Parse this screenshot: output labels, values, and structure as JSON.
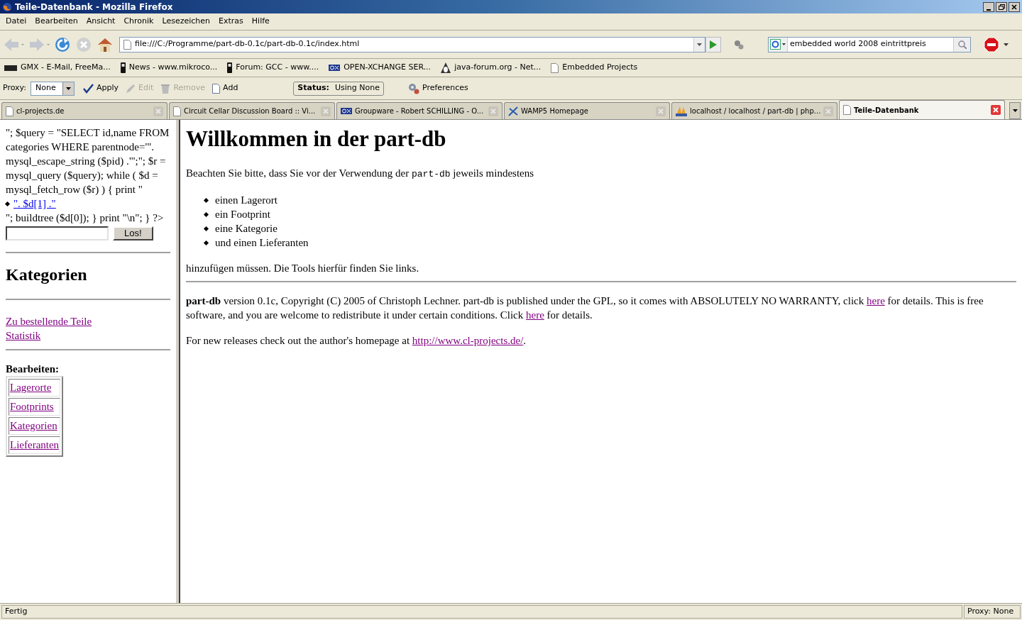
{
  "window": {
    "title": "Teile-Datenbank - Mozilla Firefox"
  },
  "menu": [
    "Datei",
    "Bearbeiten",
    "Ansicht",
    "Chronik",
    "Lesezeichen",
    "Extras",
    "Hilfe"
  ],
  "navigation": {
    "url": "file:///C:/Programme/part-db-0.1c/part-db-0.1c/index.html",
    "search": "embedded world 2008 eintrittpreis"
  },
  "bookmarks": [
    {
      "label": "GMX - E-Mail, FreeMa...",
      "kind": "gmx"
    },
    {
      "label": "News - www.mikroco...",
      "kind": "phone"
    },
    {
      "label": "Forum: GCC - www....",
      "kind": "phone"
    },
    {
      "label": "OPEN-XCHANGE SER...",
      "kind": "ox"
    },
    {
      "label": "java-forum.org - Net...",
      "kind": "java"
    },
    {
      "label": "Embedded Projects",
      "kind": "page"
    }
  ],
  "proxy_toolbar": {
    "label": "Proxy:",
    "value": "None",
    "buttons": [
      {
        "label": "Apply",
        "kind": "apply",
        "disabled": false
      },
      {
        "label": "Edit",
        "kind": "edit",
        "disabled": true
      },
      {
        "label": "Remove",
        "kind": "remove",
        "disabled": true
      },
      {
        "label": "Add",
        "kind": "add",
        "disabled": false
      }
    ],
    "status_label": "Status:",
    "status_value": "Using None",
    "preferences": "Preferences"
  },
  "tabs": [
    {
      "label": "cl-projects.de",
      "kind": "page",
      "selected": false
    },
    {
      "label": "Circuit Cellar Discussion Board :: Vi...",
      "kind": "page",
      "selected": false
    },
    {
      "label": "Groupware - Robert SCHILLING - O...",
      "kind": "ox",
      "selected": false
    },
    {
      "label": "WAMP5 Homepage",
      "kind": "wamp",
      "selected": false
    },
    {
      "label": "localhost / localhost / part-db | php...",
      "kind": "pma",
      "selected": false
    },
    {
      "label": "Teile-Datenbank",
      "kind": "page",
      "selected": true
    }
  ],
  "sidebar": {
    "code_text": "\"; $query = \"SELECT id,name FROM categories WHERE parentnode='\". mysql_escape_string ($pid) .\"';\"; $r = mysql_query ($query); while ( $d = mysql_fetch_row ($r) ) { print \"",
    "bullet_link": "\". $d[1] .\"",
    "after_text": "\"; buildtree ($d[0]); } print \"\\n\"; } ?>",
    "search_button": "Los!",
    "heading": "Kategorien",
    "links": [
      "Zu bestellende Teile",
      "Statistik"
    ],
    "edit_heading": "Bearbeiten:",
    "edit_links": [
      "Lagerorte",
      "Footprints",
      "Kategorien",
      "Lieferanten"
    ]
  },
  "main": {
    "heading": "Willkommen in der part-db",
    "intro_before": "Beachten Sie bitte, dass Sie vor der Verwendung der",
    "intro_code": "part-db",
    "intro_after": "jeweils mindestens",
    "list": [
      "einen Lagerort",
      "ein Footprint",
      "eine Kategorie",
      "und einen Lieferanten"
    ],
    "outro": "hinzufügen müssen. Die Tools hierfür finden Sie links.",
    "license": [
      {
        "kind": "text",
        "text": "**part-db** version 0.1c, Copyright (C) 2005 of Christoph Lechner. part-db is published under the GPL, so it comes with ABSOLUTELY NO WARRANTY, click"
      },
      {
        "kind": "link",
        "text": "here"
      },
      {
        "kind": "text",
        "text": "for details. This is free software, and you are welcome to redistribute it under certain conditions. Click"
      },
      {
        "kind": "link",
        "text": "here"
      },
      {
        "kind": "text",
        "text": "for details."
      }
    ],
    "releases": [
      {
        "kind": "text",
        "text": "For new releases check out the author's homepage at"
      },
      {
        "kind": "link",
        "text": "http://www.cl-projects.de/"
      },
      {
        "kind": "text",
        "text": "."
      }
    ]
  },
  "status_bar": {
    "text": "Fertig",
    "proxy": "Proxy: None"
  }
}
